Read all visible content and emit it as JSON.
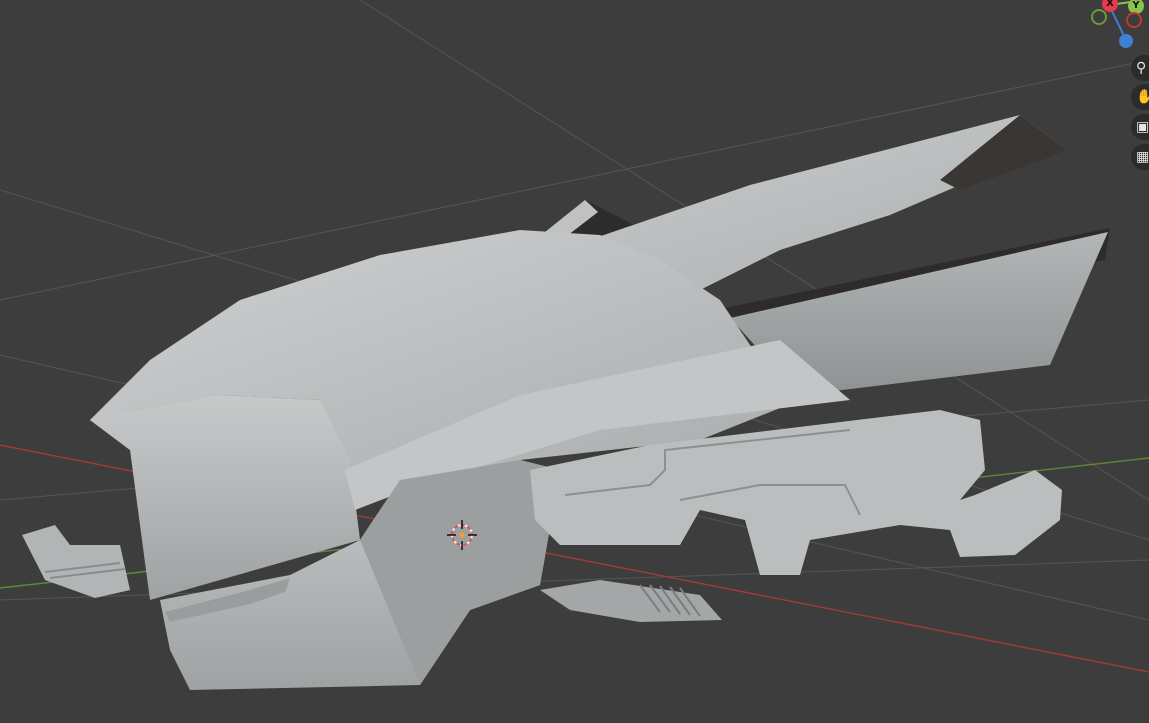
{
  "app": "Blender",
  "viewport": {
    "background": "#3d3d3d",
    "grid_color": "#555555",
    "x_axis_color": "#c0392b",
    "y_axis_color": "#6a9a3a",
    "model_color": "#b9bcbd"
  },
  "gizmo": {
    "x_label": "X",
    "y_label": "Y",
    "x_color": "#e8394f",
    "y_color": "#8bc34a",
    "z_color": "#3f7fd6"
  },
  "nav_tools": [
    {
      "name": "zoom",
      "icon": "magnifier-plus-icon",
      "glyph": "⚲"
    },
    {
      "name": "pan",
      "icon": "hand-icon",
      "glyph": "✋"
    },
    {
      "name": "camera",
      "icon": "camera-icon",
      "glyph": "▣"
    },
    {
      "name": "ortho-grid",
      "icon": "grid-icon",
      "glyph": "▦"
    }
  ]
}
